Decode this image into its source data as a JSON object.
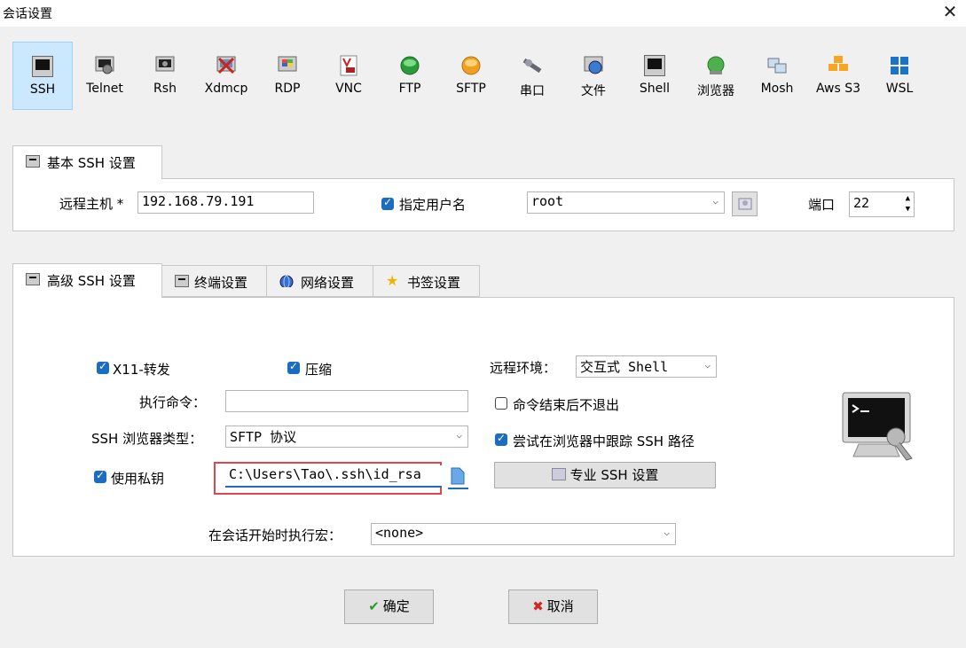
{
  "window": {
    "title": "会话设置",
    "close_glyph": "✕"
  },
  "session_types": [
    {
      "label": "SSH",
      "icon": "ssh-icon",
      "selected": true
    },
    {
      "label": "Telnet",
      "icon": "telnet-icon"
    },
    {
      "label": "Rsh",
      "icon": "rsh-icon"
    },
    {
      "label": "Xdmcp",
      "icon": "xdmcp-icon"
    },
    {
      "label": "RDP",
      "icon": "rdp-icon"
    },
    {
      "label": "VNC",
      "icon": "vnc-icon"
    },
    {
      "label": "FTP",
      "icon": "ftp-icon"
    },
    {
      "label": "SFTP",
      "icon": "sftp-icon"
    },
    {
      "label": "串口",
      "icon": "serial-icon"
    },
    {
      "label": "文件",
      "icon": "file-icon"
    },
    {
      "label": "Shell",
      "icon": "shell-icon"
    },
    {
      "label": "浏览器",
      "icon": "browser-icon"
    },
    {
      "label": "Mosh",
      "icon": "mosh-icon"
    },
    {
      "label": "Aws S3",
      "icon": "aws-s3-icon"
    },
    {
      "label": "WSL",
      "icon": "wsl-icon"
    }
  ],
  "basic": {
    "tab_label": "基本 SSH 设置",
    "remote_host_label": "远程主机 *",
    "remote_host_value": "192.168.79.191",
    "specify_user_label": "指定用户名",
    "specify_user_checked": true,
    "username_value": "root",
    "port_label": "端口",
    "port_value": "22"
  },
  "advanced_tabs": [
    {
      "label": "高级 SSH 设置",
      "icon": "terminal-icon",
      "active": true
    },
    {
      "label": "终端设置",
      "icon": "terminal-settings-icon"
    },
    {
      "label": "网络设置",
      "icon": "globe-icon"
    },
    {
      "label": "书签设置",
      "icon": "star-icon"
    }
  ],
  "advanced": {
    "x11_label": "X11-转发",
    "x11_checked": true,
    "compress_label": "压缩",
    "compress_checked": true,
    "remote_env_label": "远程环境：",
    "remote_env_value": "交互式 Shell",
    "exec_cmd_label": "执行命令：",
    "exec_cmd_value": "",
    "no_exit_label": "命令结束后不退出",
    "no_exit_checked": false,
    "browser_type_label": "SSH 浏览器类型：",
    "browser_type_value": "SFTP 协议",
    "follow_path_label": "尝试在浏览器中跟踪 SSH 路径",
    "follow_path_checked": true,
    "private_key_label": "使用私钥",
    "private_key_checked": true,
    "private_key_value": "C:\\Users\\Tao\\.ssh\\id_rsa",
    "expert_button_label": "专业 SSH 设置",
    "macro_label": "在会话开始时执行宏：",
    "macro_value": "<none>"
  },
  "buttons": {
    "ok_label": "确定",
    "cancel_label": "取消"
  },
  "colors": {
    "selection_bg": "#cce8ff",
    "check_blue": "#1a6dc0",
    "highlight_red": "#e0474c"
  }
}
